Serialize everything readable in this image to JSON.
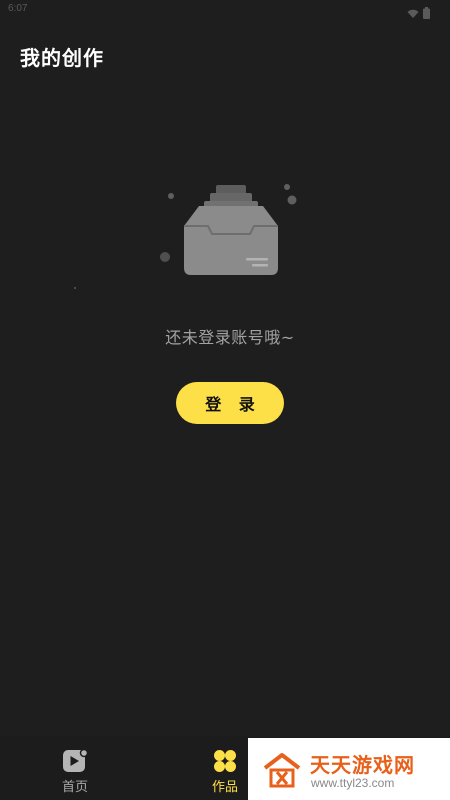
{
  "status_bar": {
    "time": "6:07",
    "icons": [
      "wifi-icon",
      "battery-icon"
    ]
  },
  "header": {
    "title": "我的创作"
  },
  "empty_state": {
    "icon": "empty-inbox-icon",
    "message": "还未登录账号哦~",
    "login_label": "登 录"
  },
  "bottom_nav": {
    "items": [
      {
        "label": "首页",
        "icon": "play-video-icon",
        "active": false
      },
      {
        "label": "作品",
        "icon": "four-petal-grid-icon",
        "active": true
      }
    ]
  },
  "watermark": {
    "title": "天天游戏网",
    "url": "www.ttyl23.com",
    "icon": "house-logo-icon"
  },
  "colors": {
    "background": "#1e1e1e",
    "accent": "#fde047",
    "nav_background": "#1c1c1c",
    "text_muted": "#a2a2a2",
    "watermark_orange": "#e8611a"
  }
}
